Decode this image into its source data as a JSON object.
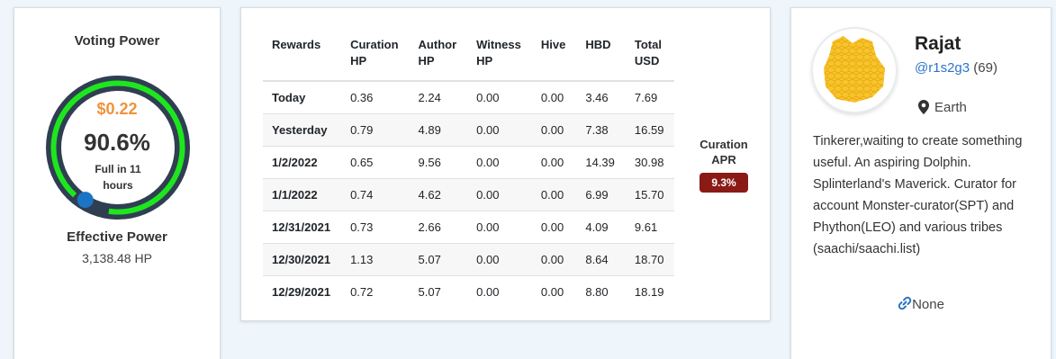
{
  "voting_power": {
    "title": "Voting Power",
    "usd": "$0.22",
    "percent_label": "90.6%",
    "percent": 90.6,
    "full_in": "Full in 11 hours",
    "effective_title": "Effective Power",
    "effective_value": "3,138.48 HP",
    "colors": {
      "ring_track": "#2f3e51",
      "ring_fill": "#1ee61e",
      "knob": "#1c74c4",
      "usd": "#f0923a"
    }
  },
  "rewards": {
    "headers": [
      [
        "Rewards"
      ],
      [
        "Curation",
        "HP"
      ],
      [
        "Author",
        "HP"
      ],
      [
        "Witness",
        "HP"
      ],
      [
        "Hive"
      ],
      [
        "HBD"
      ],
      [
        "Total",
        "USD"
      ]
    ],
    "rows": [
      [
        "Today",
        "0.36",
        "2.24",
        "0.00",
        "0.00",
        "3.46",
        "7.69"
      ],
      [
        "Yesterday",
        "0.79",
        "4.89",
        "0.00",
        "0.00",
        "7.38",
        "16.59"
      ],
      [
        "1/2/2022",
        "0.65",
        "9.56",
        "0.00",
        "0.00",
        "14.39",
        "30.98"
      ],
      [
        "1/1/2022",
        "0.74",
        "4.62",
        "0.00",
        "0.00",
        "6.99",
        "15.70"
      ],
      [
        "12/31/2021",
        "0.73",
        "2.66",
        "0.00",
        "0.00",
        "4.09",
        "9.61"
      ],
      [
        "12/30/2021",
        "1.13",
        "5.07",
        "0.00",
        "0.00",
        "8.64",
        "18.70"
      ],
      [
        "12/29/2021",
        "0.72",
        "5.07",
        "0.00",
        "0.00",
        "8.80",
        "18.19"
      ]
    ],
    "apr_label_1": "Curation",
    "apr_label_2": "APR",
    "apr_value": "9.3%",
    "apr_color": "#8a1a16"
  },
  "profile": {
    "name": "Rajat",
    "handle": "@r1s2g3",
    "reputation": "(69)",
    "location": "Earth",
    "bio": "Tinkerer,waiting to create something useful. An aspiring Dolphin. Splinterland's Maverick. Curator for account Monster-curator(SPT) and Phython(LEO) and various tribes (saachi/saachi.list)",
    "website": "None",
    "icons": {
      "location": "map-marker-icon",
      "website": "link-icon"
    },
    "avatar_color": "#f7c42c"
  }
}
